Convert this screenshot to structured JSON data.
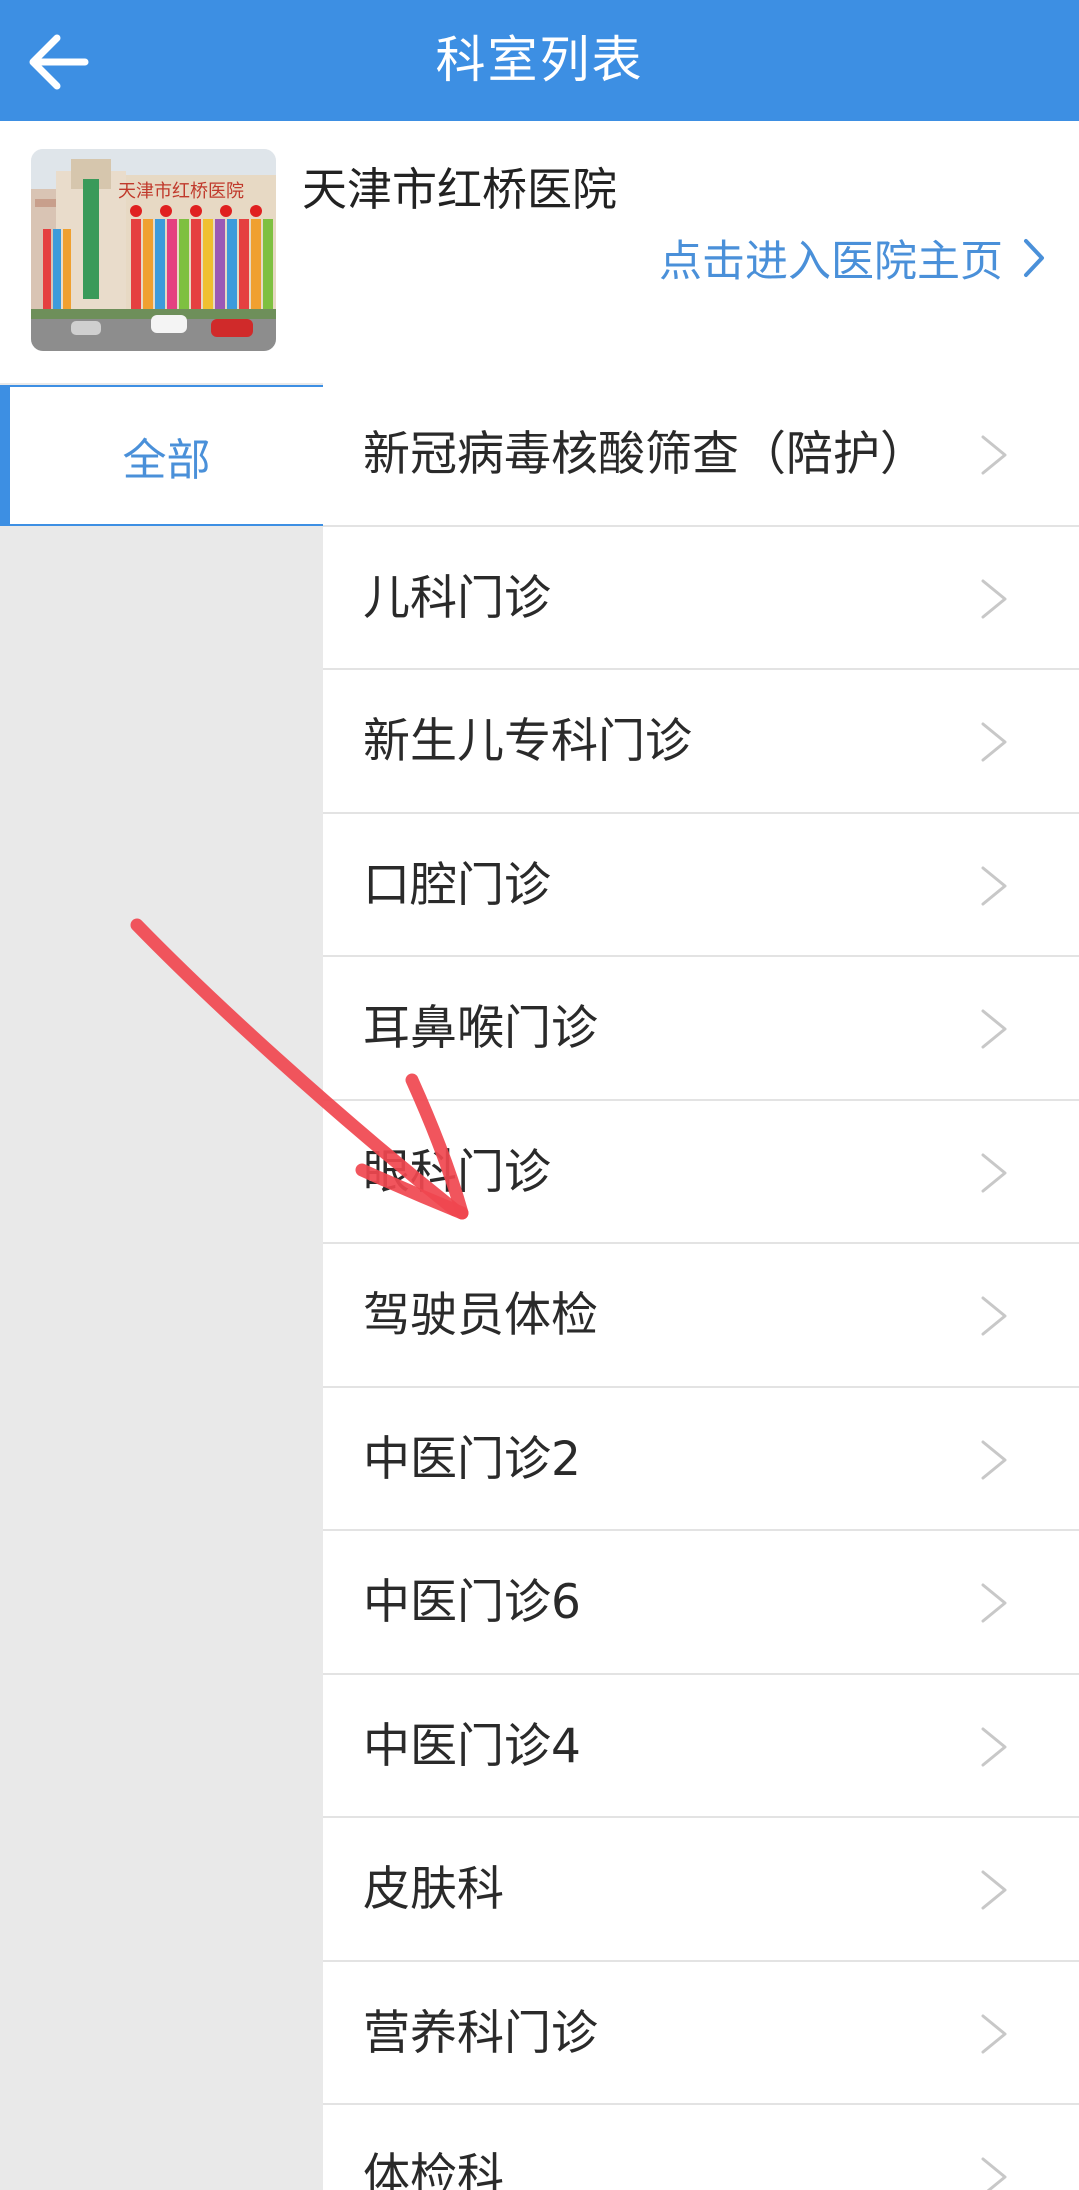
{
  "header": {
    "title": "科室列表",
    "back_icon": "arrow-left-icon",
    "background": "#3d8fe3"
  },
  "hospital": {
    "name": "天津市红桥医院",
    "link_label": "点击进入医院主页",
    "link_color": "#4a90d9",
    "photo_sign": "天津市红桥医院"
  },
  "sidebar": {
    "items": [
      {
        "label": "全部",
        "active": true
      }
    ]
  },
  "departments": [
    {
      "label": "新冠病毒核酸筛查（陪护）"
    },
    {
      "label": "儿科门诊"
    },
    {
      "label": "新生儿专科门诊"
    },
    {
      "label": "口腔门诊"
    },
    {
      "label": "耳鼻喉门诊"
    },
    {
      "label": "眼科门诊"
    },
    {
      "label": "驾驶员体检"
    },
    {
      "label": "中医门诊2"
    },
    {
      "label": "中医门诊6"
    },
    {
      "label": "中医门诊4"
    },
    {
      "label": "皮肤科"
    },
    {
      "label": "营养科门诊"
    },
    {
      "label": "体检科"
    }
  ],
  "annotation": {
    "type": "hand-drawn arrow",
    "color": "#f0474f"
  }
}
